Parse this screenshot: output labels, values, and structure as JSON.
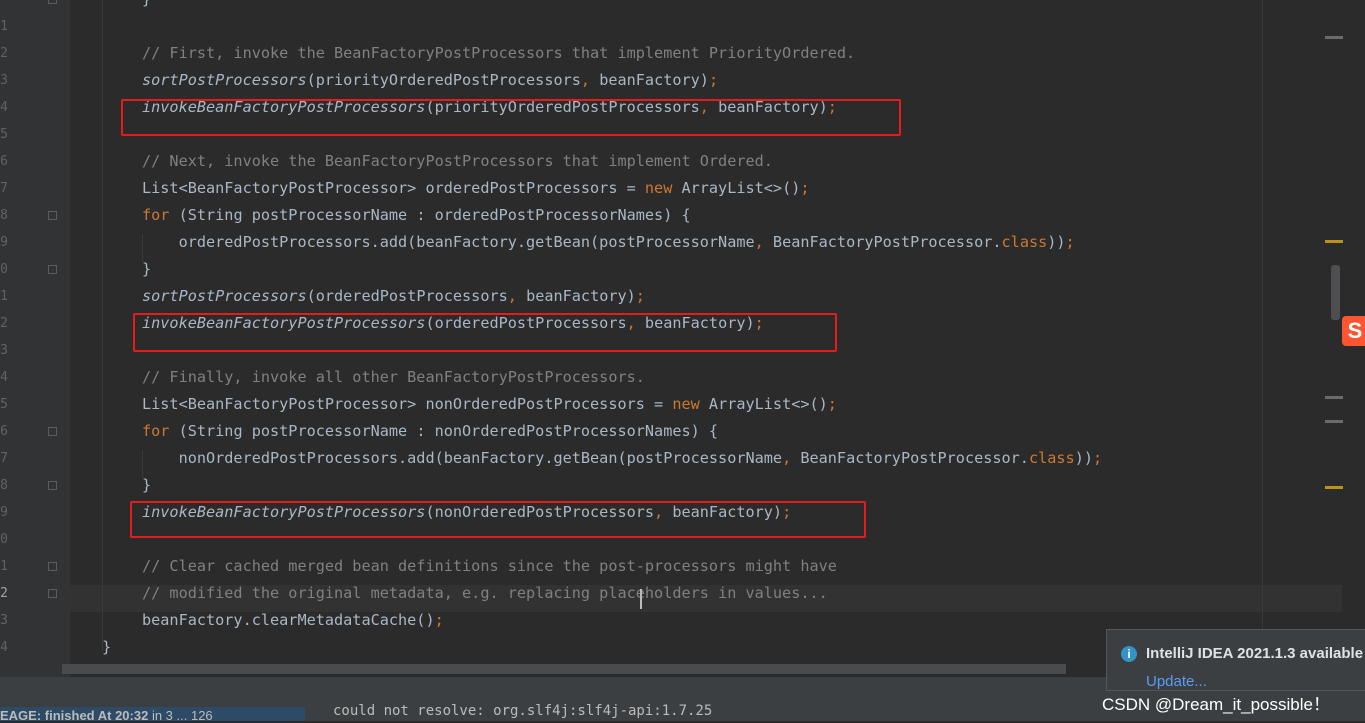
{
  "editor": {
    "lines": [
      {
        "num": "",
        "segments": [
          {
            "t": "}",
            "c": ""
          }
        ]
      },
      {
        "num": "1",
        "segments": []
      },
      {
        "num": "2",
        "segments": [
          {
            "t": "// First, invoke the BeanFactoryPostProcessors that implement PriorityOrdered.",
            "c": "cm"
          }
        ]
      },
      {
        "num": "3",
        "segments": [
          {
            "t": "sortPostProcessors",
            "c": "it"
          },
          {
            "t": "(priorityOrderedPostProcessors",
            "c": ""
          },
          {
            "t": ",",
            "c": "kw"
          },
          {
            "t": " beanFactory)",
            "c": ""
          },
          {
            "t": ";",
            "c": "kw"
          }
        ]
      },
      {
        "num": "4",
        "segments": [
          {
            "t": "invokeBeanFactoryPostProcessors",
            "c": "it"
          },
          {
            "t": "(priorityOrderedPostProcessors",
            "c": ""
          },
          {
            "t": ",",
            "c": "kw"
          },
          {
            "t": " beanFactory)",
            "c": ""
          },
          {
            "t": ";",
            "c": "kw"
          }
        ]
      },
      {
        "num": "5",
        "segments": []
      },
      {
        "num": "6",
        "segments": [
          {
            "t": "// Next, invoke the BeanFactoryPostProcessors that implement Ordered.",
            "c": "cm"
          }
        ]
      },
      {
        "num": "7",
        "segments": [
          {
            "t": "List<BeanFactoryPostProcessor> orderedPostProcessors = ",
            "c": ""
          },
          {
            "t": "new",
            "c": "kw"
          },
          {
            "t": " ArrayList<>()",
            "c": ""
          },
          {
            "t": ";",
            "c": "kw"
          }
        ]
      },
      {
        "num": "8",
        "segments": [
          {
            "t": "for",
            "c": "kw"
          },
          {
            "t": " (String postProcessorName : orderedPostProcessorNames) {",
            "c": ""
          }
        ]
      },
      {
        "num": "9",
        "segments": [
          {
            "t": "    orderedPostProcessors.add(beanFactory.getBean(postProcessorName",
            "c": ""
          },
          {
            "t": ",",
            "c": "kw"
          },
          {
            "t": " BeanFactoryPostProcessor.",
            "c": ""
          },
          {
            "t": "class",
            "c": "kw"
          },
          {
            "t": "))",
            "c": ""
          },
          {
            "t": ";",
            "c": "kw"
          }
        ]
      },
      {
        "num": "0",
        "segments": [
          {
            "t": "}",
            "c": ""
          }
        ]
      },
      {
        "num": "1",
        "segments": [
          {
            "t": "sortPostProcessors",
            "c": "it"
          },
          {
            "t": "(orderedPostProcessors",
            "c": ""
          },
          {
            "t": ",",
            "c": "kw"
          },
          {
            "t": " beanFactory)",
            "c": ""
          },
          {
            "t": ";",
            "c": "kw"
          }
        ]
      },
      {
        "num": "2",
        "segments": [
          {
            "t": "invokeBeanFactoryPostProcessors",
            "c": "it"
          },
          {
            "t": "(orderedPostProcessors",
            "c": ""
          },
          {
            "t": ",",
            "c": "kw"
          },
          {
            "t": " beanFactory)",
            "c": ""
          },
          {
            "t": ";",
            "c": "kw"
          }
        ]
      },
      {
        "num": "3",
        "segments": []
      },
      {
        "num": "4",
        "segments": [
          {
            "t": "// Finally, invoke all other BeanFactoryPostProcessors.",
            "c": "cm"
          }
        ]
      },
      {
        "num": "5",
        "segments": [
          {
            "t": "List<BeanFactoryPostProcessor> nonOrderedPostProcessors = ",
            "c": ""
          },
          {
            "t": "new",
            "c": "kw"
          },
          {
            "t": " ArrayList<>()",
            "c": ""
          },
          {
            "t": ";",
            "c": "kw"
          }
        ]
      },
      {
        "num": "6",
        "segments": [
          {
            "t": "for",
            "c": "kw"
          },
          {
            "t": " (String postProcessorName : nonOrderedPostProcessorNames) {",
            "c": ""
          }
        ]
      },
      {
        "num": "7",
        "segments": [
          {
            "t": "    nonOrderedPostProcessors.add(beanFactory.getBean(postProcessorName",
            "c": ""
          },
          {
            "t": ",",
            "c": "kw"
          },
          {
            "t": " BeanFactoryPostProcessor.",
            "c": ""
          },
          {
            "t": "class",
            "c": "kw"
          },
          {
            "t": "))",
            "c": ""
          },
          {
            "t": ";",
            "c": "kw"
          }
        ]
      },
      {
        "num": "8",
        "segments": [
          {
            "t": "}",
            "c": ""
          }
        ]
      },
      {
        "num": "9",
        "segments": [
          {
            "t": "invokeBeanFactoryPostProcessors",
            "c": "it"
          },
          {
            "t": "(nonOrderedPostProcessors",
            "c": ""
          },
          {
            "t": ",",
            "c": "kw"
          },
          {
            "t": " beanFactory)",
            "c": ""
          },
          {
            "t": ";",
            "c": "kw"
          }
        ]
      },
      {
        "num": "0",
        "segments": []
      },
      {
        "num": "1",
        "segments": [
          {
            "t": "// Clear cached merged bean definitions since the post-processors might have",
            "c": "cm"
          }
        ]
      },
      {
        "num": "2",
        "segments": [
          {
            "t": "// modified the original metadata, e.g. replacing placeholders in values...",
            "c": "cm"
          }
        ]
      },
      {
        "num": "3",
        "segments": [
          {
            "t": "beanFactory.clearMetadataCache()",
            "c": ""
          },
          {
            "t": ";",
            "c": "kw"
          }
        ]
      },
      {
        "num": "4",
        "segments": [
          {
            "t": "}",
            "c": ""
          }
        ]
      }
    ]
  },
  "notification": {
    "title": "IntelliJ IDEA 2021.1.3 available",
    "link": "Update...",
    "icon": "info-icon"
  },
  "run_panel": {
    "status": "EAGE: finished At 20:32",
    "extra": "in 3 ... 126"
  },
  "console": {
    "line": "could not resolve: org.slf4j:slf4j-api:1.7.25"
  },
  "watermark": "CSDN @Dream_it_possible！",
  "logo": "S",
  "colors": {
    "editor_bg": "#2b2b2b",
    "comment": "#808080",
    "keyword": "#cc7832",
    "text": "#a9b7c6",
    "highlight_box": "#e51c1c",
    "warning_mark": "#be9117",
    "link": "#589df6"
  }
}
